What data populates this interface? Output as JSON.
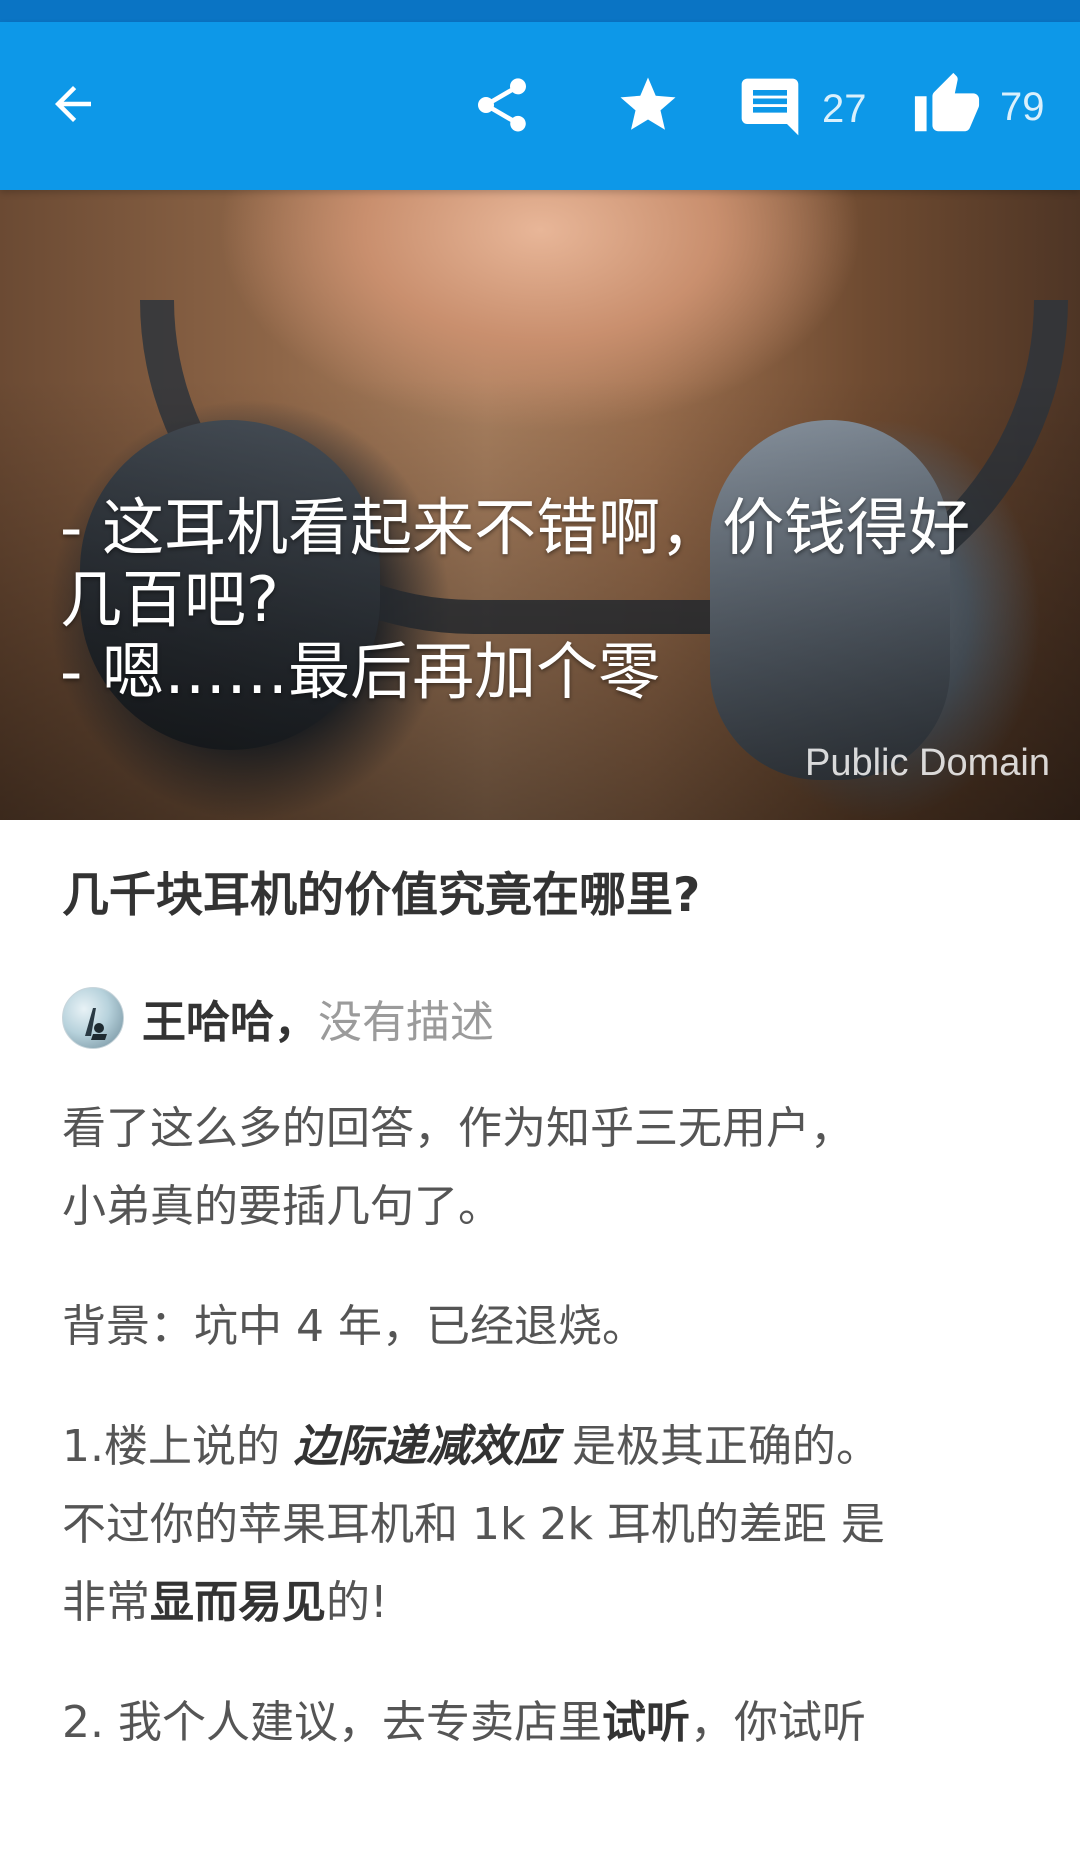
{
  "appbar": {
    "comment_count": "27",
    "like_count": "79",
    "bg_color": "#0d98e8"
  },
  "hero": {
    "caption_line1": "- 这耳机看起来不错啊，价钱得好",
    "caption_line2": "几百吧?",
    "caption_line3": "- 嗯……最后再加个零",
    "credit": "Public Domain"
  },
  "article": {
    "title": "几千块耳机的价值究竟在哪里?",
    "author_name": "王哈哈，",
    "author_desc": "没有描述",
    "p1_line1": "看了这么多的回答，作为知乎三无用户，",
    "p1_line2": "小弟真的要插几句了。",
    "p2": "背景：坑中 4 年，已经退烧。",
    "p3_a": "1.楼上说的 ",
    "p3_em": "边际递减效应",
    "p3_b": " 是极其正确的。",
    "p3_line2": "不过你的苹果耳机和 1k 2k 耳机的差距 是",
    "p3_c": "非常",
    "p3_bold": "显而易见",
    "p3_d": "的!",
    "p4_a": "2. 我个人建议，去专卖店里",
    "p4_bold": "试听",
    "p4_b": "，你试听"
  },
  "icons": {
    "back": "arrow-left-icon",
    "share": "share-icon",
    "star": "star-icon",
    "comment": "comment-icon",
    "like": "thumbs-up-icon"
  }
}
